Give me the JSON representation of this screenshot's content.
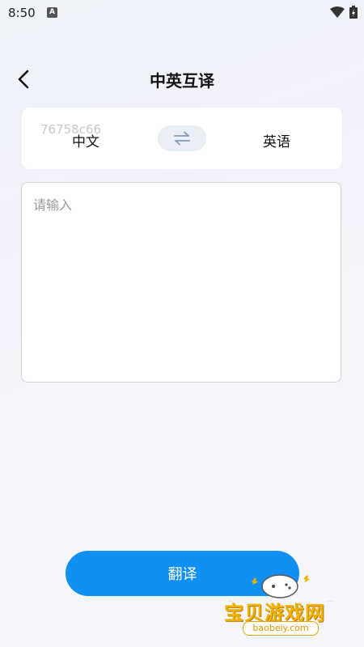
{
  "status_bar": {
    "time": "8:50",
    "notification_badge": "A"
  },
  "header": {
    "title": "中英互译"
  },
  "language_selector": {
    "watermark": "76758c66",
    "source_language": "中文",
    "target_language": "英语"
  },
  "input": {
    "placeholder": "请输入",
    "value": ""
  },
  "actions": {
    "translate_label": "翻译"
  },
  "watermark_logo": {
    "text": "宝贝游戏网",
    "url": "baobeiy.com"
  },
  "colors": {
    "accent": "#1190f3",
    "background": "#f4f5fa",
    "card": "#ffffff",
    "swap_bg": "#eaeef6",
    "logo": "#f1b300"
  },
  "icons": {
    "back": "chevron-left-icon",
    "swap": "swap-arrows-icon",
    "wifi": "wifi-icon",
    "battery": "battery-icon"
  }
}
